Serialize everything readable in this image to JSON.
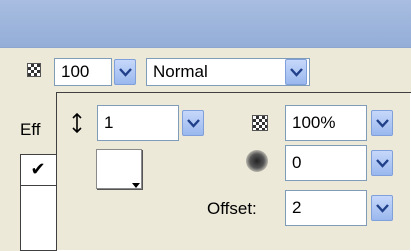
{
  "toolbar": {
    "opacity_icon": "checker-icon",
    "opacity_value": "100",
    "blend_mode": "Normal"
  },
  "effects_panel": {
    "tab_label": "Eff",
    "checkmark": "✔"
  },
  "shadow_popup": {
    "distance_icon": "vertical-arrows-icon",
    "distance_value": "1",
    "shadow_opacity_value": "100%",
    "blur_value": "0",
    "offset_label": "Offset:",
    "offset_value": "2",
    "shadow_color": "#ffffff"
  },
  "colors": {
    "titlebar": "#a8bde0",
    "dropdown_button": "#9ab8ee",
    "field_border": "#7f9db9",
    "background": "#ece9d8"
  }
}
